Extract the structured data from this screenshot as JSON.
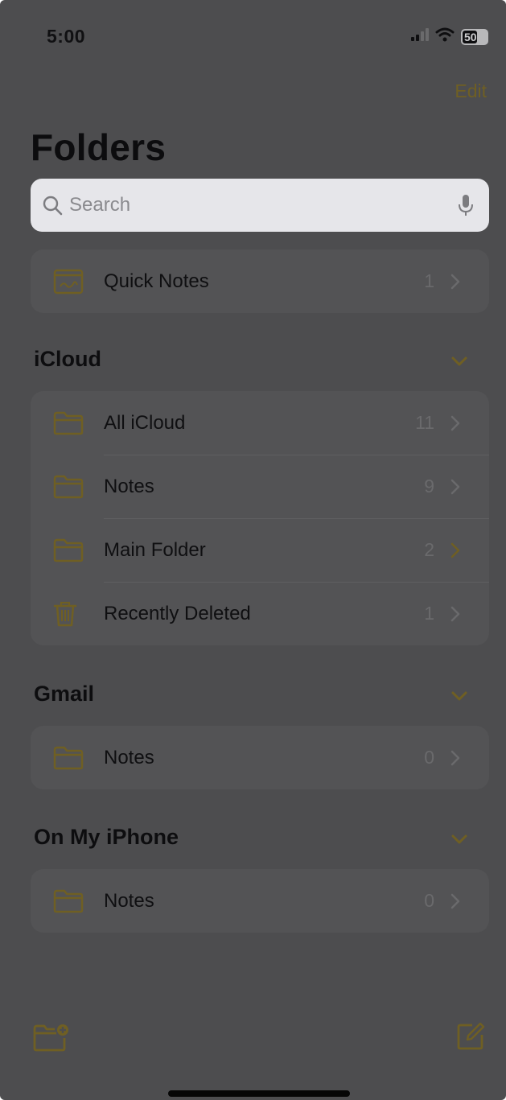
{
  "status_bar": {
    "time": "5:00",
    "battery": "50"
  },
  "header": {
    "edit_label": "Edit",
    "title": "Folders"
  },
  "search": {
    "placeholder": "Search"
  },
  "quick_notes": {
    "label": "Quick Notes",
    "count": "1"
  },
  "sections": {
    "icloud": {
      "title": "iCloud",
      "items": [
        {
          "label": "All iCloud",
          "count": "11"
        },
        {
          "label": "Notes",
          "count": "9"
        },
        {
          "label": "Main Folder",
          "count": "2"
        },
        {
          "label": "Recently Deleted",
          "count": "1"
        }
      ]
    },
    "gmail": {
      "title": "Gmail",
      "items": [
        {
          "label": "Notes",
          "count": "0"
        }
      ]
    },
    "on_my_iphone": {
      "title": "On My iPhone",
      "items": [
        {
          "label": "Notes",
          "count": "0"
        }
      ]
    }
  },
  "colors": {
    "overlay_background": "#4d4d4f",
    "group_background": "#535355",
    "accent_dim": "#6f5f23",
    "search_background": "#e6e6ea"
  },
  "icons": [
    "cellular-signal-icon",
    "wifi-icon",
    "battery-icon",
    "search-icon",
    "microphone-icon",
    "quick-notes-icon",
    "folder-icon",
    "trash-icon",
    "chevron-right-icon",
    "chevron-down-icon",
    "new-folder-icon",
    "compose-icon"
  ]
}
